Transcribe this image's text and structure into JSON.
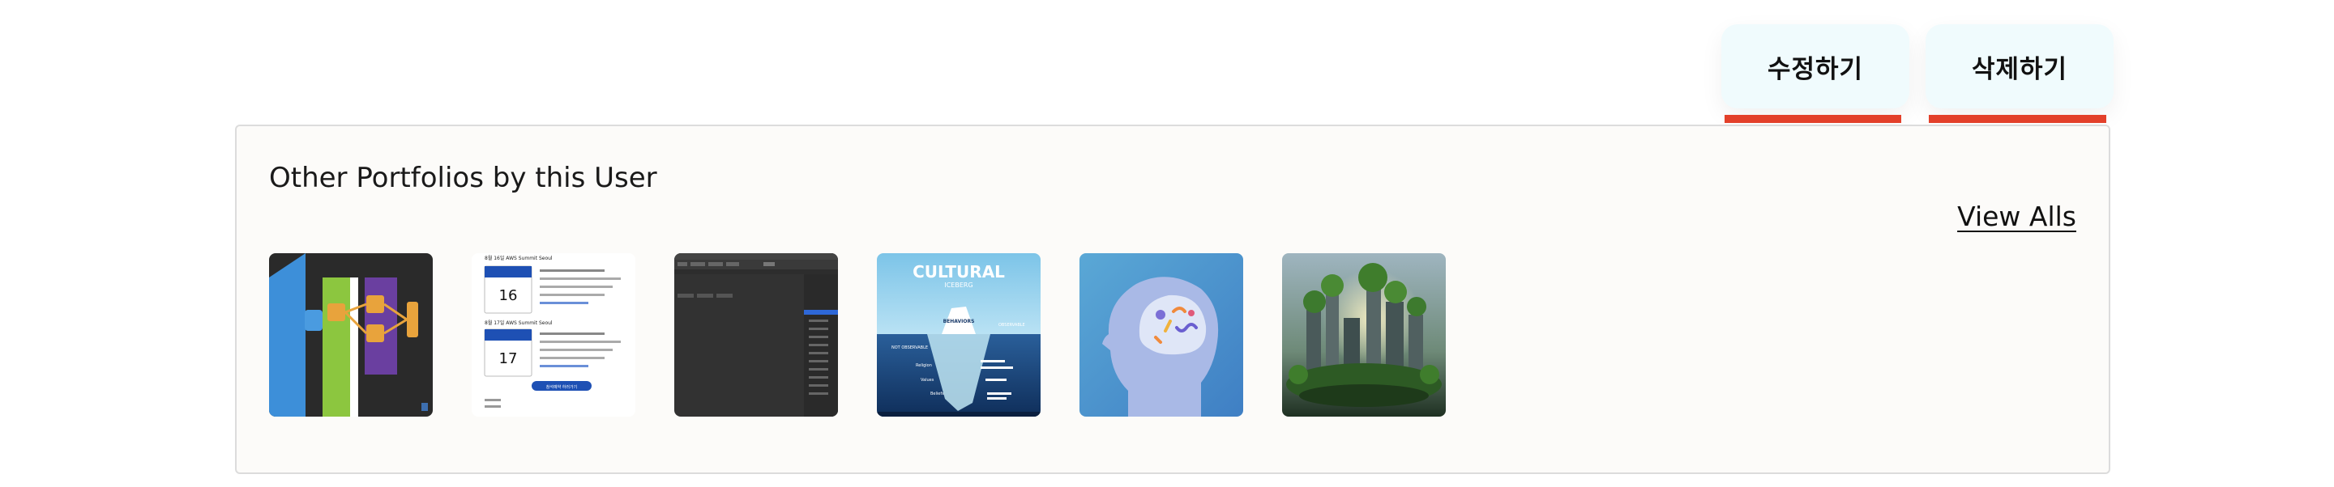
{
  "actions": {
    "edit_label": "수정하기",
    "delete_label": "삭제하기"
  },
  "portfolios": {
    "title": "Other Portfolios by this User",
    "view_all_label": "View Alls",
    "thumb2": {
      "heading_1": "8월 16일 AWS Summit Seoul",
      "heading_2": "8월 17일 AWS Summit Seoul",
      "day_1": "16",
      "day_2": "17",
      "button": "참석예약 하러가기"
    },
    "thumb4": {
      "title": "CULTURAL",
      "subtitle": "ICEBERG",
      "behaviors": "BEHAVIORS",
      "observable": "OBSERVABLE",
      "not_observable": "NOT OBSERVABLE",
      "religion": "Religion",
      "values": "Values",
      "beliefs": "Beliefs"
    }
  },
  "colors": {
    "button_bg": "#f0fbfd",
    "underline": "#e3402a",
    "panel_bg": "#fcfbf9"
  }
}
